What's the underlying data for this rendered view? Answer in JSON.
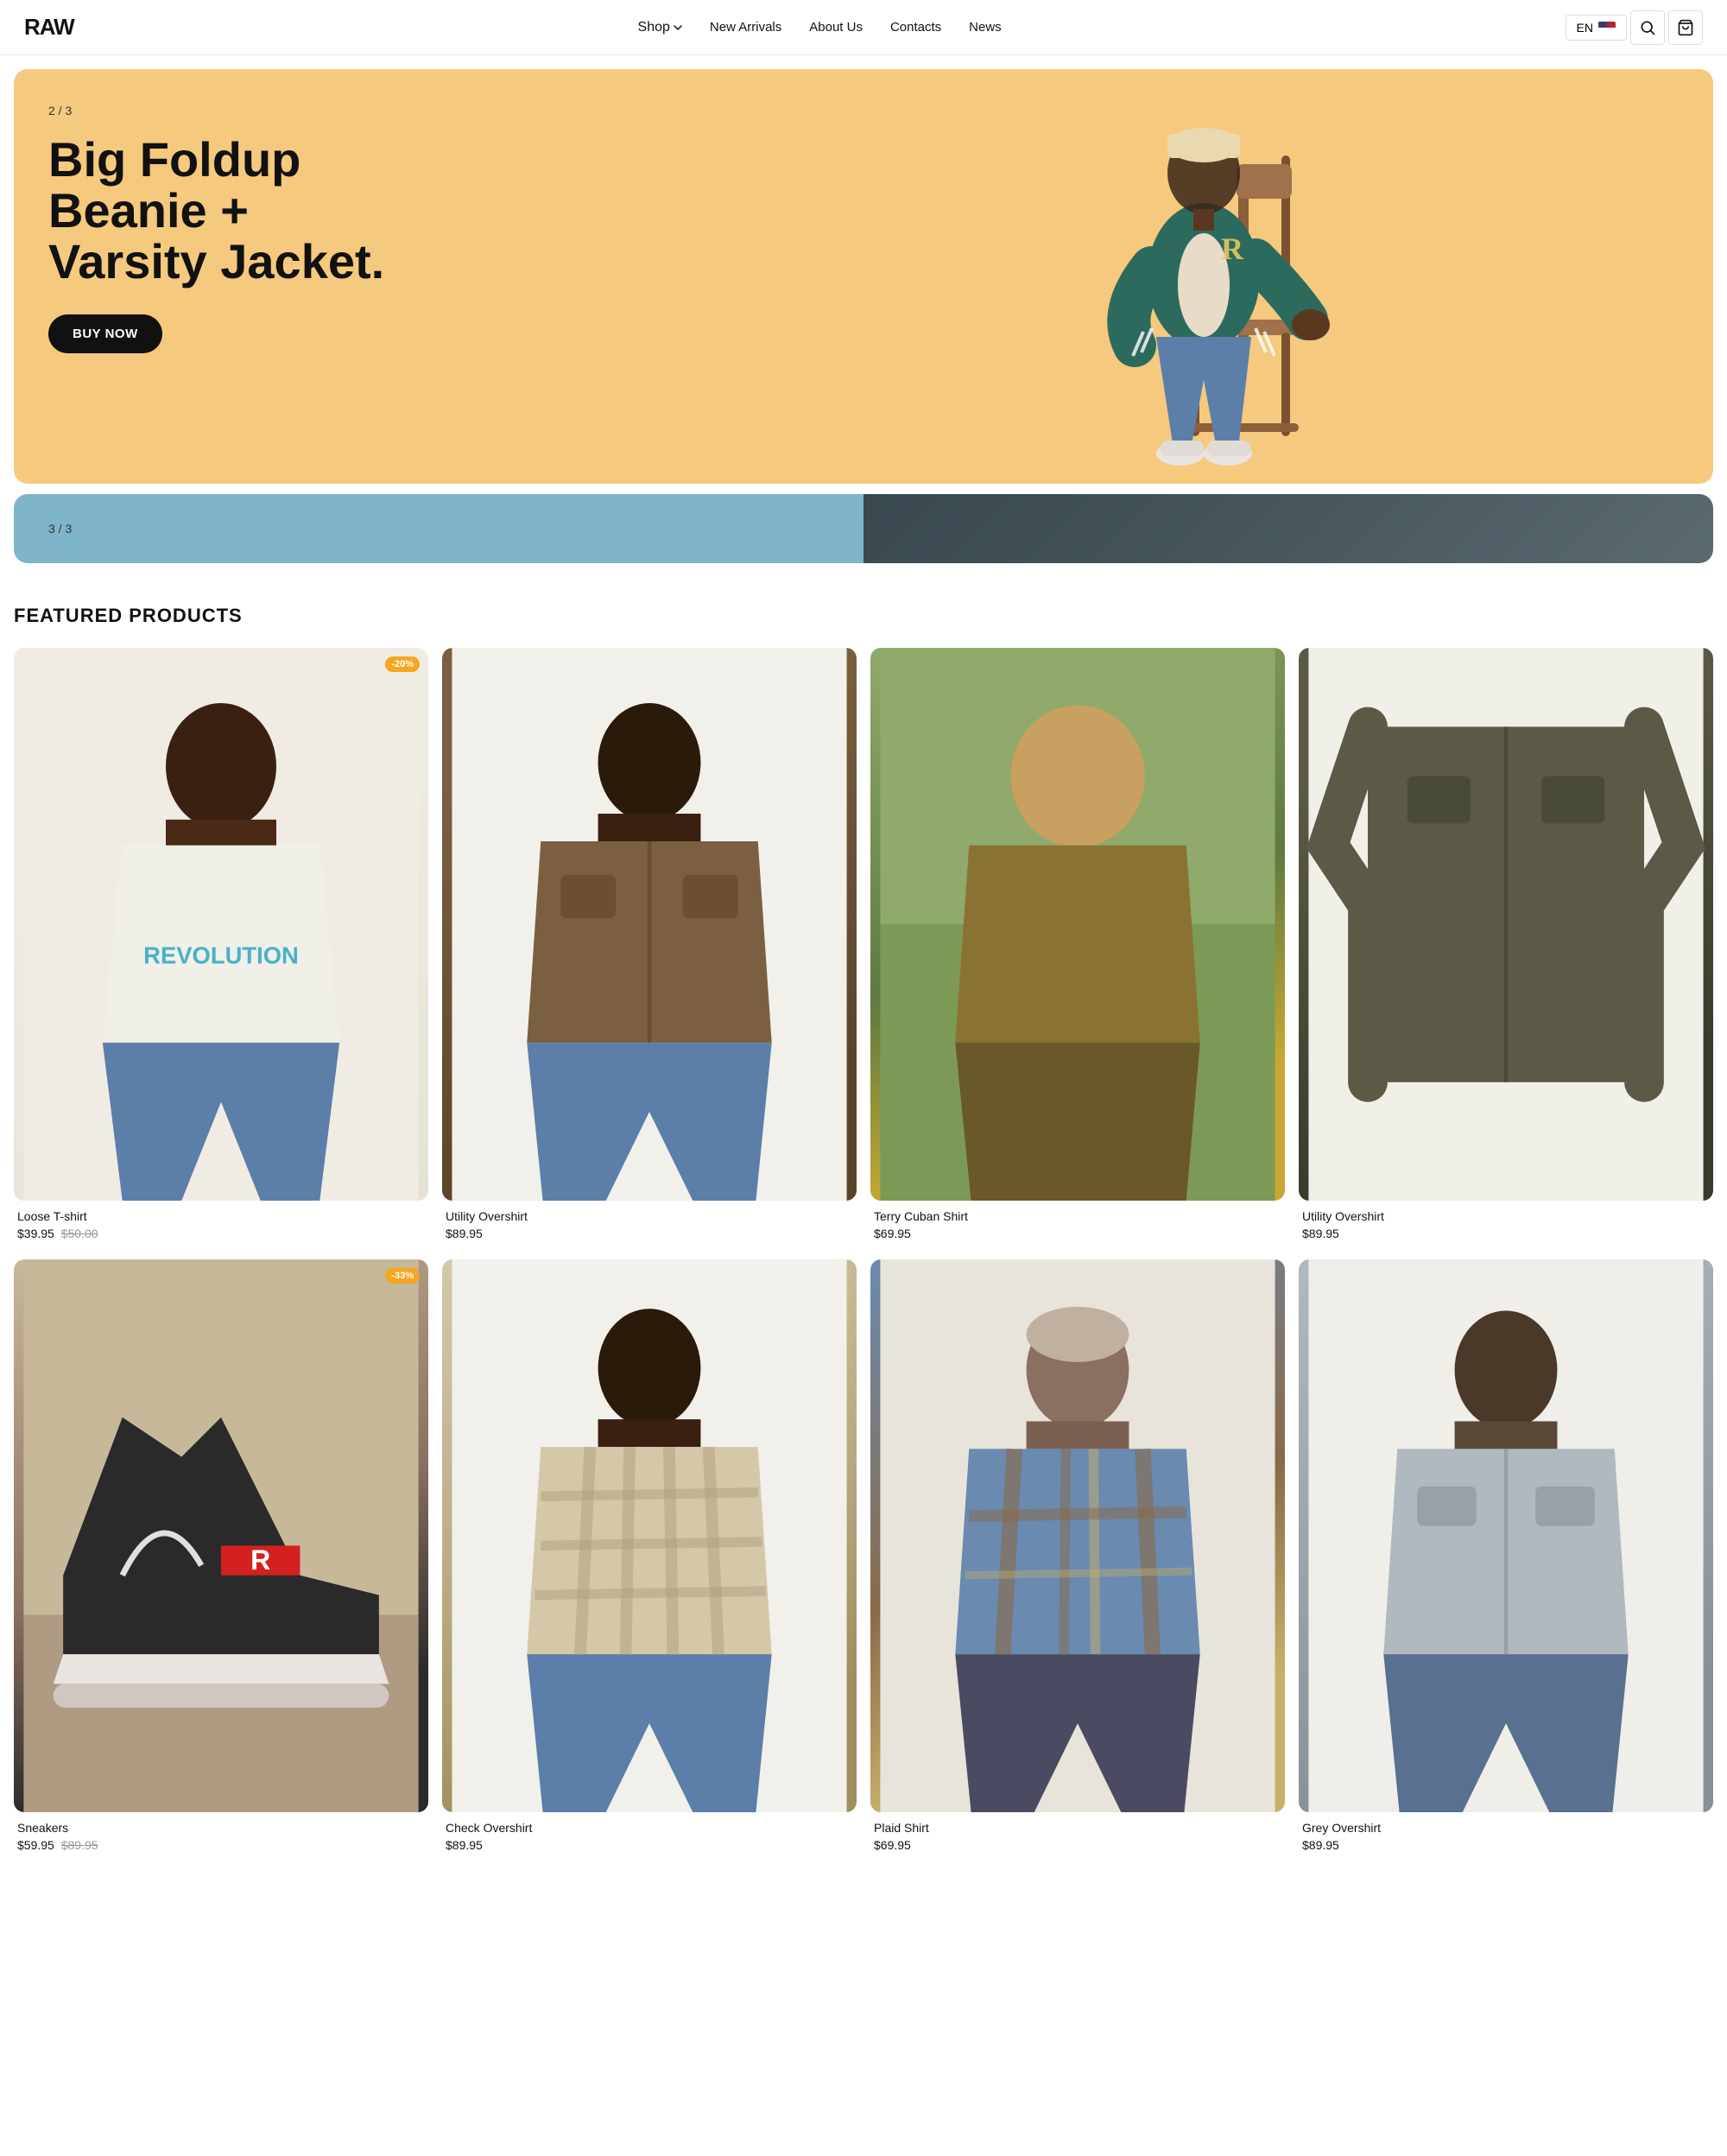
{
  "brand": {
    "name": "RAW"
  },
  "nav": {
    "shop_label": "Shop",
    "new_arrivals_label": "New Arrivals",
    "about_us_label": "About Us",
    "contacts_label": "Contacts",
    "news_label": "News"
  },
  "header": {
    "lang": "EN",
    "search_label": "Search",
    "cart_label": "Cart"
  },
  "hero": {
    "slide1": {
      "counter": "2 / 3",
      "title": "Big Foldup\nBeanie +\nVarsity Jacket.",
      "cta_label": "BUY NOW"
    },
    "slide2": {
      "counter": "3 / 3"
    }
  },
  "featured": {
    "section_title": "FEATURED PRODUCTS",
    "products": [
      {
        "name": "Loose T-shirt",
        "price": "$39.95",
        "original_price": "$50.00",
        "discount": "-20%",
        "has_discount": true,
        "image_class": "img-tshirt"
      },
      {
        "name": "Utility Overshirt",
        "price": "$89.95",
        "original_price": null,
        "has_discount": false,
        "image_class": "img-overshirt-brown"
      },
      {
        "name": "Terry Cuban Shirt",
        "price": "$69.95",
        "original_price": null,
        "has_discount": false,
        "image_class": "img-cuban"
      },
      {
        "name": "Utility Overshirt",
        "price": "$89.95",
        "original_price": null,
        "has_discount": false,
        "image_class": "img-overshirt-dark"
      },
      {
        "name": "Sneakers",
        "price": "$59.95",
        "original_price": "$89.95",
        "discount": "-33%",
        "has_discount": true,
        "image_class": "img-shoes"
      },
      {
        "name": "Check Overshirt",
        "price": "$89.95",
        "original_price": null,
        "has_discount": false,
        "image_class": "img-check-shirt"
      },
      {
        "name": "Plaid Shirt",
        "price": "$69.95",
        "original_price": null,
        "has_discount": false,
        "image_class": "img-plaid"
      },
      {
        "name": "Grey Overshirt",
        "price": "$89.95",
        "original_price": null,
        "has_discount": false,
        "image_class": "img-grey-shirt"
      }
    ]
  }
}
